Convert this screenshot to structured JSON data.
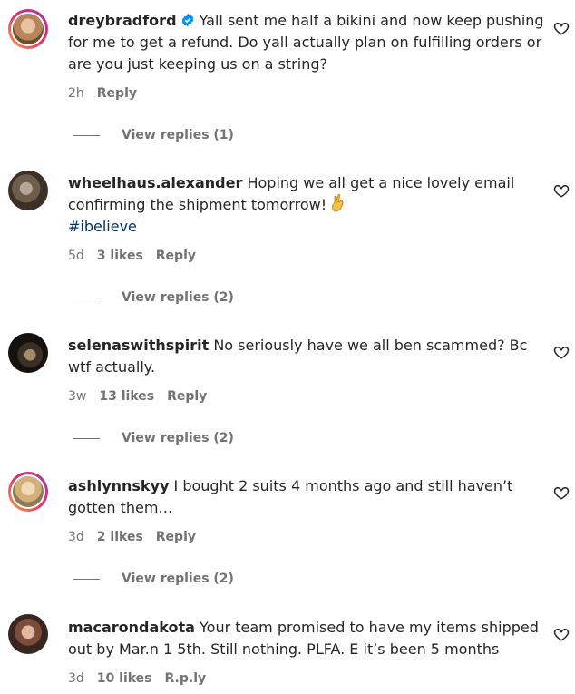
{
  "comments": [
    {
      "username": "dreybradford",
      "text": "Yall sent me half a bikini and now keep pushing for me to get a refund. Do yall actually plan on fulfilling orders or are you just keeping us on a string?",
      "time": "2h",
      "likes": "",
      "reply": "Reply",
      "view_replies": "View replies (1)"
    },
    {
      "username": "wheelhaus.alexander",
      "text": "Hoping we all get a nice lovely email confirming the shipment tomorrow!",
      "hashtag": "#ibelieve",
      "time": "5d",
      "likes": "3 likes",
      "reply": "Reply",
      "view_replies": "View replies (2)"
    },
    {
      "username": "selenaswithspirit",
      "text": "No seriously have we all ben scammed? Bc wtf actually.",
      "time": "3w",
      "likes": "13 likes",
      "reply": "Reply",
      "view_replies": "View replies (2)"
    },
    {
      "username": "ashlynnskyy",
      "text": "I bought 2 suits 4 months ago and still haven’t gotten them…",
      "time": "3d",
      "likes": "2 likes",
      "reply": "Reply",
      "view_replies": "View replies (2)"
    },
    {
      "username": "macarondakota",
      "text": "Your team promised to have my items shipped out by Mar.n 1 5th. Still nothing. PLFA. E it’s been 5 months",
      "time": "3d",
      "likes": "10 likes",
      "reply": "R.p.ly"
    }
  ],
  "icons": {
    "verified": "verified-badge-icon",
    "like": "heart-outline-icon",
    "emoji": "crossed-fingers-emoji"
  },
  "colors": {
    "verified": "#0095f6",
    "hashtag": "#00376b",
    "muted": "#737373",
    "text": "#262626"
  }
}
